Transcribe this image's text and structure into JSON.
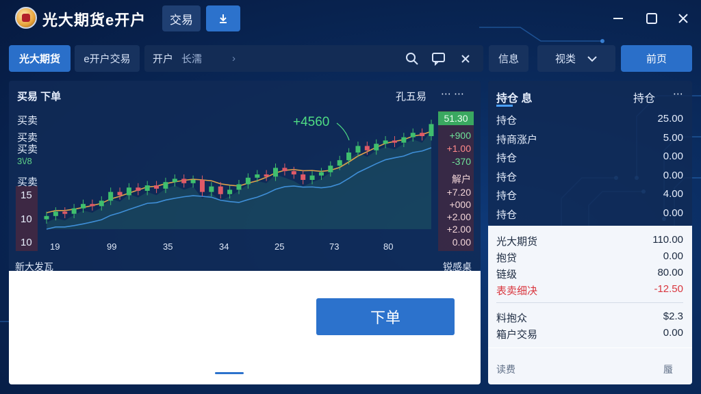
{
  "window": {
    "title": "光大期货e开户",
    "trade_tab": "交易",
    "download_icon": "download-icon",
    "minimize_icon": "minimize-icon",
    "maximize_icon": "maximize-icon",
    "close_icon": "close-icon"
  },
  "toolbar": {
    "gd_label": "光大期货",
    "open_trade_label": "e开户交易",
    "search_prefix": "开户",
    "search_value": "长濡",
    "info_label": "信息",
    "view_label": "视类",
    "home_label": "前页"
  },
  "chart_panel": {
    "title": "买易  下单",
    "right_title": "孔五易",
    "labels": [
      "买卖",
      "买卖",
      "买卖",
      "3\\/8",
      "买卖"
    ],
    "highlight_value": "+4560",
    "bottom_left": "新大发瓦",
    "bottom_right": "锐感桌"
  },
  "chart_data": {
    "type": "line",
    "yticks": [
      "15",
      "10",
      "10"
    ],
    "xticks": [
      "19",
      "99",
      "35",
      "34",
      "25",
      "73",
      "80"
    ],
    "side_values": [
      {
        "text": "51.30",
        "tone": "green-bg"
      },
      {
        "text": "+900",
        "tone": "green"
      },
      {
        "text": "+1.00",
        "tone": "red"
      },
      {
        "text": "-370",
        "tone": "green"
      },
      {
        "text": "解户",
        "tone": "plain"
      },
      {
        "text": "+7.20",
        "tone": "plain"
      },
      {
        "text": "+000",
        "tone": "plain"
      },
      {
        "text": "+2.00",
        "tone": "plain"
      },
      {
        "text": "+2.00",
        "tone": "plain"
      },
      {
        "text": "0.00",
        "tone": "plain"
      }
    ]
  },
  "positions": {
    "header": "持仓 息",
    "header_right": "持仓",
    "rows": [
      {
        "label": "持仓",
        "value": "25.00"
      },
      {
        "label": "持商涨户",
        "value": "5.00"
      },
      {
        "label": "持仓",
        "value": "0.00"
      },
      {
        "label": "持仓",
        "value": "0.00"
      },
      {
        "label": "持仓",
        "value": "4.00"
      },
      {
        "label": "持仓",
        "value": "0.00"
      }
    ]
  },
  "summary": {
    "rows": [
      {
        "label": "光大期货",
        "value": "110.00"
      },
      {
        "label": "抱贷",
        "value": "0.00"
      },
      {
        "label": "链级",
        "value": "80.00"
      },
      {
        "label": "表卖细决",
        "value": "-12.50"
      },
      {
        "label": "料抱众",
        "value": "$2.3"
      },
      {
        "label": "箱户交易",
        "value": "0.00"
      }
    ],
    "footer_left": "读费",
    "footer_right": "蜃"
  },
  "order": {
    "button_label": "下单"
  },
  "colors": {
    "accent": "#2c72cc",
    "up": "#e05a67",
    "down": "#3fbf6e",
    "negative": "#d9363e"
  }
}
